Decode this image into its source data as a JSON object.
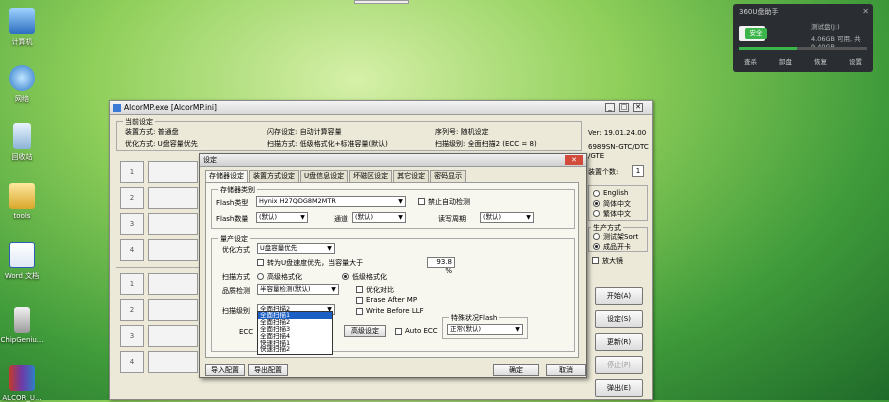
{
  "desktop": {
    "icons": [
      "计算机",
      "网络",
      "回收站",
      "tools",
      "Word 文档",
      "ChipGeniu...",
      "ALCOR_U..."
    ]
  },
  "widget360": {
    "title": "360U盘助手",
    "device": "测试盘(J:)",
    "size": "4.06GB 可用, 共 9.40GB",
    "safe_label": "安全",
    "buttons": [
      "查杀",
      "卸盘",
      "恢复",
      "设置"
    ]
  },
  "main": {
    "title": "AlcorMP.exe [AlcorMP.ini]",
    "group_title": "当前设定",
    "info": {
      "mode": "装置方式: 普通盘",
      "flash_setting": "闪存设定: 自动计算容量",
      "serial": "序列号: 随机设定",
      "optimize": "优化方式: U盘容量优先",
      "scan_mode": "扫描方式: 低级格式化+标准容量(默认)",
      "scan_level": "扫描级别: 全面扫描2 (ECC = 8)"
    },
    "version": "Ver: 19.01.24.00",
    "version2": "6989SN-GTC/DTC",
    "version3": "/GTE",
    "device_count_label": "装置个数:",
    "device_count": "1",
    "slots": [
      "1",
      "2",
      "3",
      "4",
      "1",
      "2",
      "3",
      "4"
    ],
    "lang_options": [
      "English",
      "简体中文",
      "繁体中文"
    ],
    "lang_selected": 1,
    "prod_group": "生产方式",
    "prod_options": [
      "测试架Sort",
      "成品开卡"
    ],
    "prod_selected": 1,
    "magnifier": "放大镜",
    "buttons": [
      "开始(A)",
      "设定(S)",
      "更新(R)",
      "停止(P)",
      "弹出(E)"
    ]
  },
  "dialog": {
    "title": "设定",
    "tabs": [
      "存储器设定",
      "装置方式设定",
      "U盘信息设定",
      "坏磁区设定",
      "其它设定",
      "密码显示"
    ],
    "storage_group": "存储器类别",
    "flash_type_label": "Flash类型",
    "flash_type": "Hynix H27QDG8M2MTR",
    "auto_detect": "禁止自动检测",
    "flash_count_label": "Flash数量",
    "flash_count": "(默认)",
    "channel_label": "通道",
    "channel": "(默认)",
    "read_cycle_label": "读写周期",
    "read_cycle": "(默认)",
    "prod_group": "量产设定",
    "optimize_label": "优化方式",
    "optimize": "U盘容量优先",
    "speed_first": "转为U盘速度优先，当容量大于",
    "speed_value": "93.8 %",
    "scan_label": "扫描方式",
    "scan_high": "高级格式化",
    "scan_low": "低级格式化",
    "detect_label": "品质检测",
    "detect": "半容量检测(默认)",
    "opt_compare": "优化对比",
    "erase_after": "Erase After MP",
    "write_before": "Write Before LLF",
    "level_label": "扫描级别",
    "level": "全面扫描2",
    "ecc_label": "ECC",
    "dropdown_items": [
      "全面扫描1",
      "全面扫描2",
      "全面扫描3",
      "全面扫描4",
      "快速扫描1",
      "快速扫描2"
    ],
    "dropdown_selected": 0,
    "advanced_btn": "高级设定",
    "auto_ecc": "Auto ECC",
    "special_flash": "特殊状况Flash",
    "special_value": "正常(默认)",
    "import_btn": "导入配置",
    "export_btn": "导出配置",
    "ok_btn": "确定",
    "cancel_btn": "取消"
  }
}
